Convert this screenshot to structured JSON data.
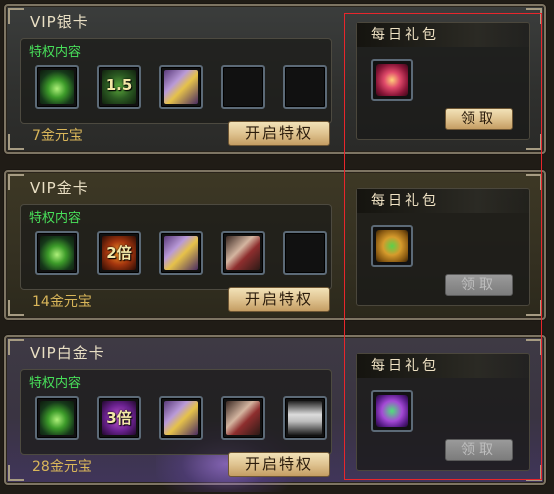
{
  "cards": [
    {
      "title": "VIP银卡",
      "perk_label": "特权内容",
      "slots": [
        {
          "icon": "green-aura-icon",
          "text": ""
        },
        {
          "icon": "multiplier-1.5-icon",
          "text": "1.5"
        },
        {
          "icon": "knight-card-icon",
          "text": ""
        },
        {
          "icon": "empty-slot",
          "text": ""
        },
        {
          "icon": "empty-slot",
          "text": ""
        }
      ],
      "price": "7金元宝",
      "open_button": "开启特权",
      "gift": {
        "title": "每日礼包",
        "claim_label": "领取",
        "claim_enabled": true,
        "icon": "red-gift-icon"
      }
    },
    {
      "title": "VIP金卡",
      "perk_label": "特权内容",
      "slots": [
        {
          "icon": "green-aura-icon",
          "text": ""
        },
        {
          "icon": "double-multiplier-icon",
          "text": "2倍"
        },
        {
          "icon": "knight-card-icon",
          "text": ""
        },
        {
          "icon": "playing-cards-icon",
          "text": ""
        },
        {
          "icon": "empty-slot",
          "text": ""
        }
      ],
      "price": "14金元宝",
      "open_button": "开启特权",
      "gift": {
        "title": "每日礼包",
        "claim_label": "领取",
        "claim_enabled": false,
        "icon": "gold-gift-icon"
      }
    },
    {
      "title": "VIP白金卡",
      "perk_label": "特权内容",
      "slots": [
        {
          "icon": "green-aura-icon",
          "text": ""
        },
        {
          "icon": "triple-multiplier-icon",
          "text": "3倍"
        },
        {
          "icon": "knight-card-icon",
          "text": ""
        },
        {
          "icon": "playing-cards-icon",
          "text": ""
        },
        {
          "icon": "ghost-icon",
          "text": ""
        }
      ],
      "price": "28金元宝",
      "open_button": "开启特权",
      "gift": {
        "title": "每日礼包",
        "claim_label": "领取",
        "claim_enabled": false,
        "icon": "purple-gift-icon"
      }
    }
  ],
  "colors": {
    "perk_label": "#48e05a",
    "price": "#d9b65a",
    "highlight_border": "#e8262c"
  }
}
